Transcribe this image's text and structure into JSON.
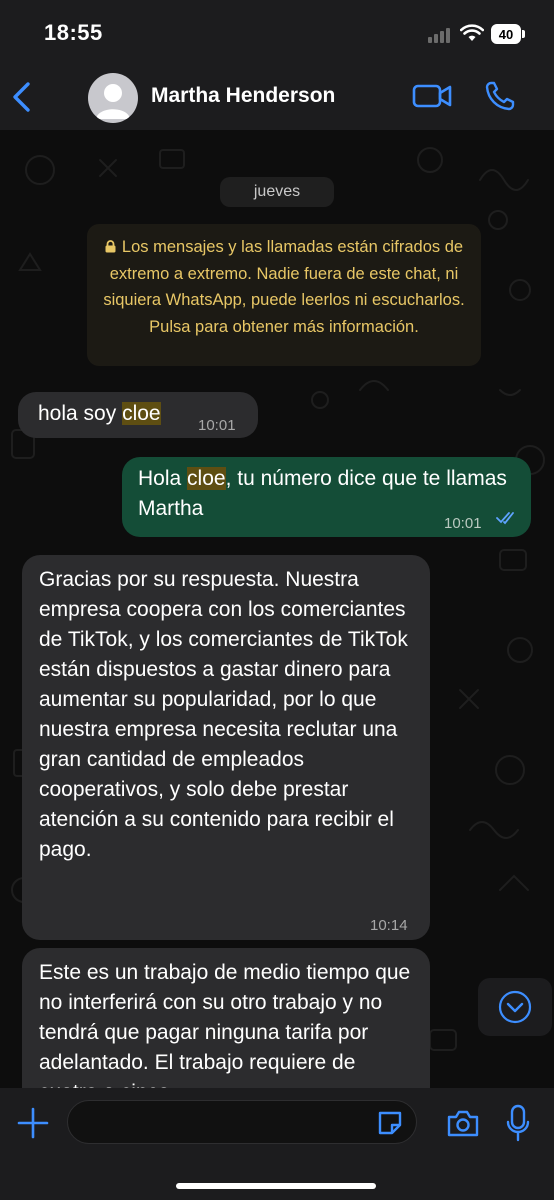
{
  "status_bar": {
    "time": "18:55",
    "battery": "40"
  },
  "header": {
    "contact_name": "Martha Henderson"
  },
  "chat": {
    "date_divider": "jueves",
    "encryption_notice": "Los mensajes y las llamadas están cifrados de extremo a extremo. Nadie fuera de este chat, ni siquiera WhatsApp, puede leerlos ni escucharlos. Pulsa para obtener más información.",
    "messages": [
      {
        "direction": "incoming",
        "text_before": "hola soy ",
        "highlight": "cloe",
        "text_after": "",
        "time": "10:01"
      },
      {
        "direction": "outgoing",
        "text_before": "Hola ",
        "highlight": "cloe",
        "text_after": ", tu número dice que te llamas Martha",
        "time": "10:01",
        "status": "read"
      },
      {
        "direction": "incoming",
        "text": "Gracias por su respuesta. Nuestra empresa coopera con los comerciantes de TikTok, y los comerciantes de TikTok están dispuestos a gastar dinero para aumentar su popularidad, por lo que nuestra empresa necesita reclutar una gran cantidad de empleados cooperativos, y solo debe prestar atención a su contenido para recibir el pago.",
        "time": "10:14"
      },
      {
        "direction": "incoming",
        "text": "Este es un trabajo de medio tiempo que no interferirá con su otro trabajo y no tendrá que pagar ninguna tarifa por adelantado. El trabajo requiere de cuatro a cinco",
        "time": ""
      }
    ]
  },
  "input": {
    "placeholder": ""
  },
  "colors": {
    "accent": "#3d8eff",
    "outgoing_bubble": "#144d37",
    "incoming_bubble": "#2c2c2e",
    "notice_text": "#e8c766"
  }
}
